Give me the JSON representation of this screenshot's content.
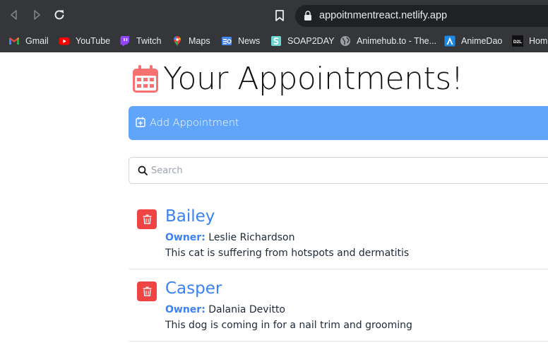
{
  "browser": {
    "url": "appoitnmentreact.netlify.app",
    "bookmarks": [
      {
        "label": "Gmail",
        "icon": "gmail-icon"
      },
      {
        "label": "YouTube",
        "icon": "youtube-icon"
      },
      {
        "label": "Twitch",
        "icon": "twitch-icon"
      },
      {
        "label": "Maps",
        "icon": "maps-icon"
      },
      {
        "label": "News",
        "icon": "news-icon"
      },
      {
        "label": "SOAP2DAY",
        "icon": "soap2day-icon"
      },
      {
        "label": "Animehub.to - The...",
        "icon": "globe-icon"
      },
      {
        "label": "AnimeDao",
        "icon": "animedao-icon"
      },
      {
        "label": "Hom",
        "icon": "d2l-icon"
      }
    ],
    "d2l_icon_text": "D2L"
  },
  "page": {
    "title": "Your Appointments!",
    "add_label": "Add Appointment",
    "search_placeholder": "Search",
    "search_value": "",
    "owner_label": "Owner:",
    "appointments": [
      {
        "pet": "Bailey",
        "owner": "Leslie Richardson",
        "notes": "This cat is suffering from hotspots and dermatitis"
      },
      {
        "pet": "Casper",
        "owner": "Dalania Devitto",
        "notes": "This dog is coming in for a nail trim and grooming"
      }
    ]
  },
  "colors": {
    "chrome_bg": "#35363a",
    "omnibox_bg": "#202124",
    "accent_blue": "#60a5fa",
    "link_blue": "#3b82f6",
    "delete_red": "#ef4444",
    "calendar_red": "#f87171"
  }
}
